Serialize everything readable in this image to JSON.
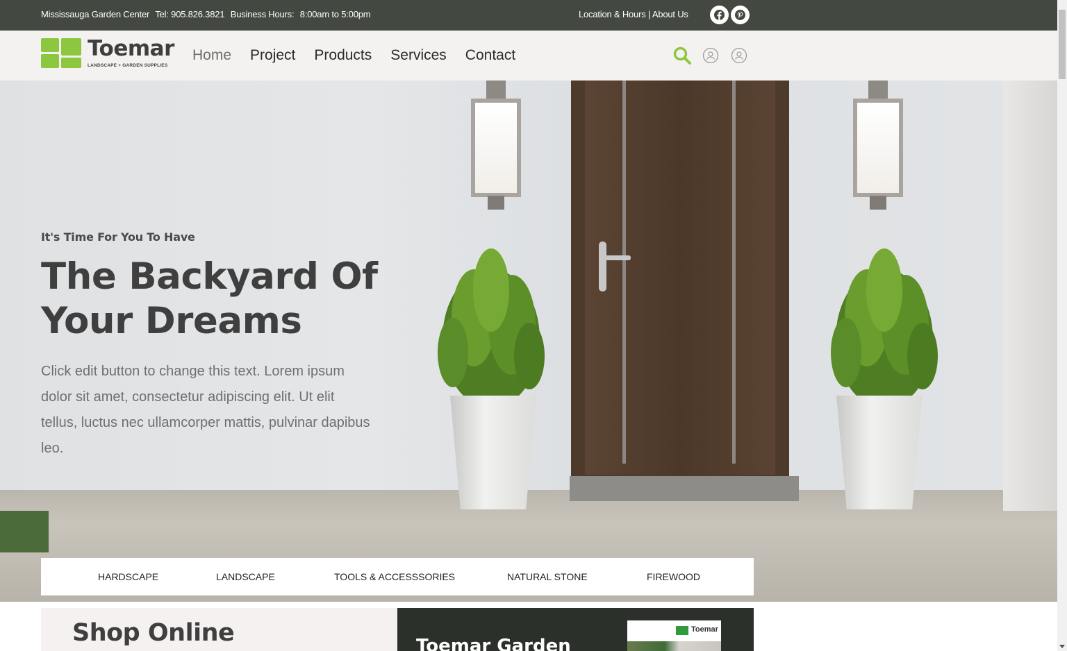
{
  "topbar": {
    "location_name": "Mississauga Garden Center",
    "phone": "Tel: 905.826.3821",
    "hours_label": "Business Hours:",
    "hours": "8:00am to 5:00pm",
    "location_link": "Location & Hours",
    "separator": "|",
    "about_link": "About Us",
    "social": [
      "facebook-icon",
      "pinterest-icon"
    ]
  },
  "header": {
    "logo_name": "Toemar",
    "logo_tagline": "LANDSCAPE + GARDEN SUPPLIES",
    "nav": [
      {
        "label": "Home",
        "active": true
      },
      {
        "label": "Project"
      },
      {
        "label": "Products"
      },
      {
        "label": "Services"
      },
      {
        "label": "Contact"
      }
    ],
    "icons": [
      "search-icon",
      "user-icon",
      "account-icon"
    ]
  },
  "hero": {
    "kicker": "It's Time For You To Have",
    "title_line1": "The Backyard Of",
    "title_line2": "Your Dreams",
    "body": "Click edit button to change this text. Lorem ipsum dolor sit amet, consectetur adipiscing elit. Ut elit tellus, luctus nec ullamcorper mattis, pulvinar dapibus leo."
  },
  "categories": [
    "HARDSCAPE",
    "LANDSCAPE",
    "TOOLS & ACCESSSORIES",
    "NATURAL STONE",
    "FIREWOOD"
  ],
  "sections": {
    "shop_title": "Shop Online",
    "garden_title": "Toemar Garden",
    "thumb_brand": "Toemar"
  },
  "colors": {
    "accent_green": "#8dc63f",
    "topbar_bg": "#434840",
    "header_bg": "#f4f2f1",
    "dark_panel": "#2b302b"
  }
}
